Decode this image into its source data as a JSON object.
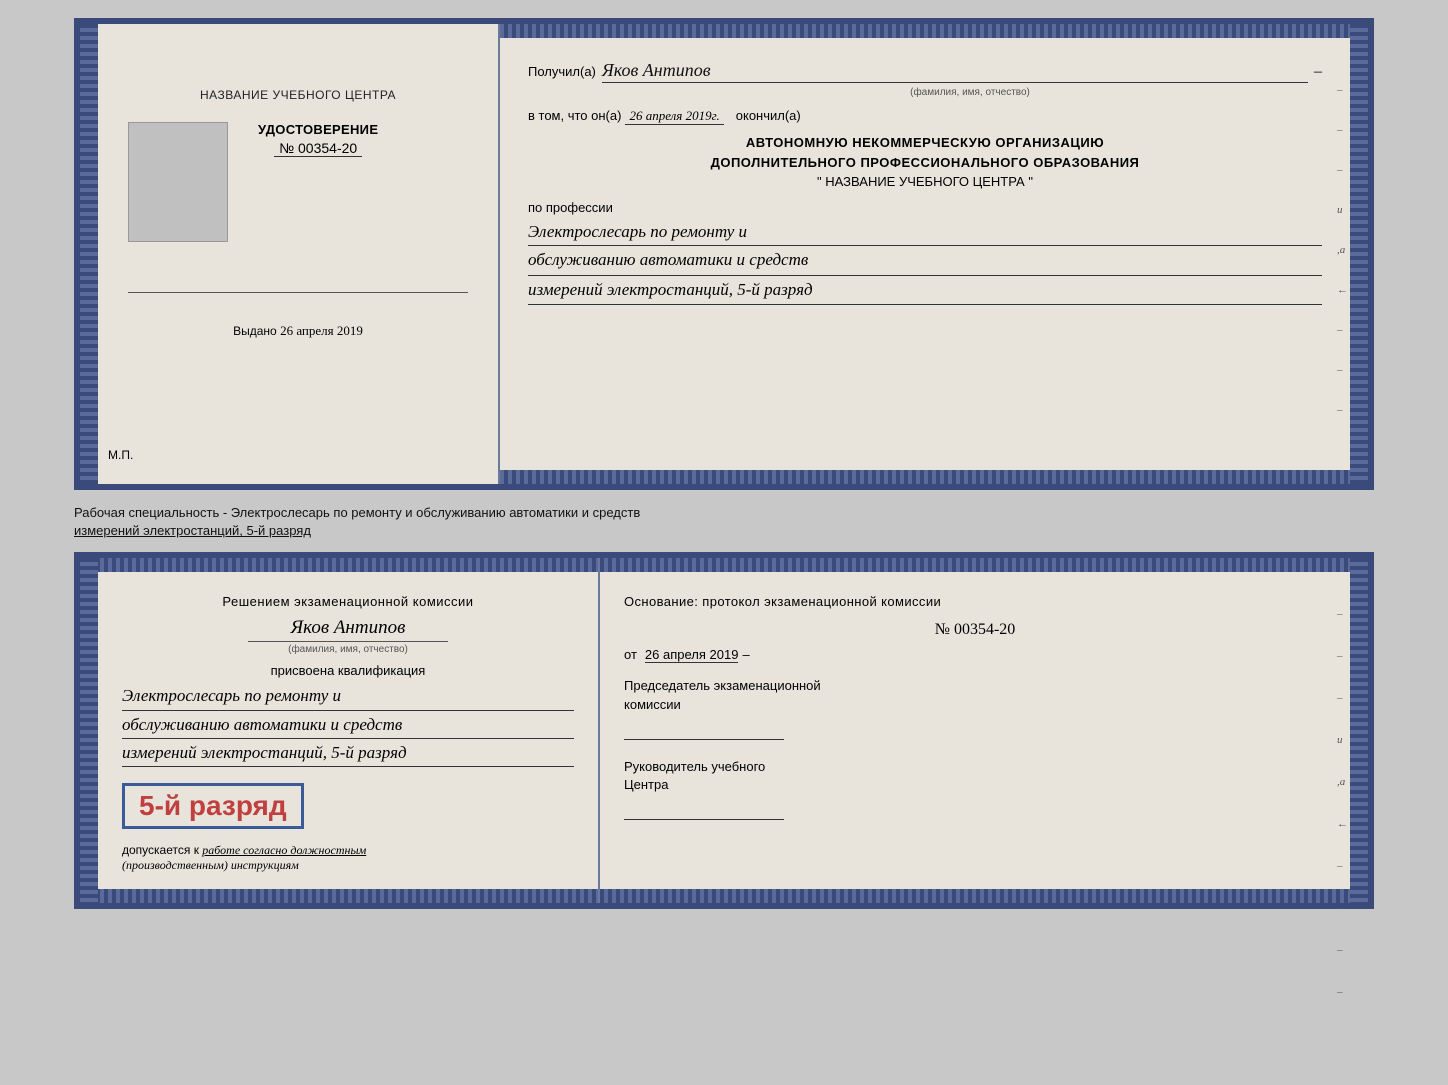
{
  "top_doc": {
    "left": {
      "center_name": "НАЗВАНИЕ УЧЕБНОГО ЦЕНТРА",
      "udostoverenie_title": "УДОСТОВЕРЕНИЕ",
      "udostoverenie_number": "№ 00354-20",
      "vydano_label": "Выдано",
      "vydano_date": "26 апреля 2019",
      "mp_label": "М.П."
    },
    "right": {
      "poluchil_label": "Получил(а)",
      "poluchil_name": "Яков Антипов",
      "fio_caption": "(фамилия, имя, отчество)",
      "vtom_label": "в том, что он(а)",
      "vtom_date": "26 апреля 2019г.",
      "okonchil_label": "окончил(а)",
      "org_line1": "АВТОНОМНУЮ НЕКОММЕРЧЕСКУЮ ОРГАНИЗАЦИЮ",
      "org_line2": "ДОПОЛНИТЕЛЬНОГО ПРОФЕССИОНАЛЬНОГО ОБРАЗОВАНИЯ",
      "org_line3": "\" НАЗВАНИЕ УЧЕБНОГО ЦЕНТРА \"",
      "po_professii": "по профессии",
      "profession_line1": "Электрослесарь по ремонту и",
      "profession_line2": "обслуживанию автоматики и средств",
      "profession_line3": "измерений электростанций, 5-й разряд"
    }
  },
  "between_text": "Рабочая специальность - Электрослесарь по ремонту и обслуживанию автоматики и средств\nизмерений электростанций, 5-й разряд",
  "bottom_doc": {
    "left": {
      "resheniye_title": "Решением экзаменационной комиссии",
      "name_handwritten": "Яков Антипов",
      "fio_caption": "(фамилия, имя, отчество)",
      "prisvoena": "присвоена квалификация",
      "qual_line1": "Электрослесарь по ремонту и",
      "qual_line2": "обслуживанию автоматики и средств",
      "qual_line3": "измерений электростанций, 5-й разряд",
      "razryad_badge": "5-й разряд",
      "dopuskaetsya_label": "допускается к",
      "dopuskaetsya_text": "работе согласно должностным",
      "dopuskaetsya_text2": "(производственным) инструкциям"
    },
    "right": {
      "osnovaniye": "Основание: протокол экзаменационной комиссии",
      "protocol_number": "№ 00354-20",
      "ot_label": "от",
      "ot_date": "26 апреля 2019",
      "predsedatel_line1": "Председатель экзаменационной",
      "predsedatel_line2": "комиссии",
      "rukovoditel_line1": "Руководитель учебного",
      "rukovoditel_line2": "Центра"
    }
  }
}
